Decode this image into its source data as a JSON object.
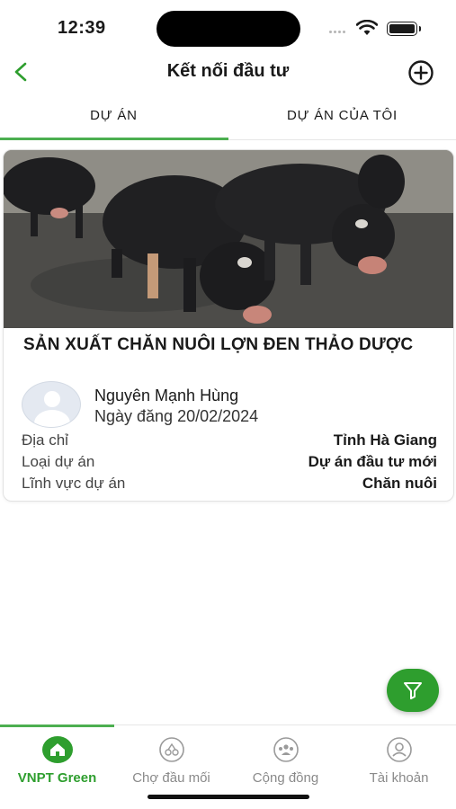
{
  "status_bar": {
    "time": "12:39"
  },
  "header": {
    "title": "Kết nối đầu tư"
  },
  "tabs": [
    {
      "label": "DỰ ÁN",
      "active": true
    },
    {
      "label": "DỰ ÁN CỦA TÔI",
      "active": false
    }
  ],
  "project": {
    "title": "SẢN XUẤT CHĂN NUÔI LỢN ĐEN THẢO DƯỢC",
    "author": "Nguyên Mạnh Hùng",
    "date_label": "Ngày đăng",
    "date": "20/02/2024",
    "details": [
      {
        "label": "Địa chỉ",
        "value": "Tỉnh Hà Giang"
      },
      {
        "label": "Loại dự án",
        "value": "Dự án đầu tư mới"
      },
      {
        "label": "Lĩnh vực dự án",
        "value": "Chăn nuôi"
      }
    ]
  },
  "bottom_nav": [
    {
      "label": "VNPT Green",
      "icon": "home-icon",
      "active": true
    },
    {
      "label": "Chợ đầu mối",
      "icon": "market-icon",
      "active": false
    },
    {
      "label": "Cộng đồng",
      "icon": "community-icon",
      "active": false
    },
    {
      "label": "Tài khoản",
      "icon": "account-icon",
      "active": false
    }
  ],
  "colors": {
    "accent": "#4caf50",
    "fab": "#2e9e2e",
    "inactive": "#8a8a8a"
  }
}
